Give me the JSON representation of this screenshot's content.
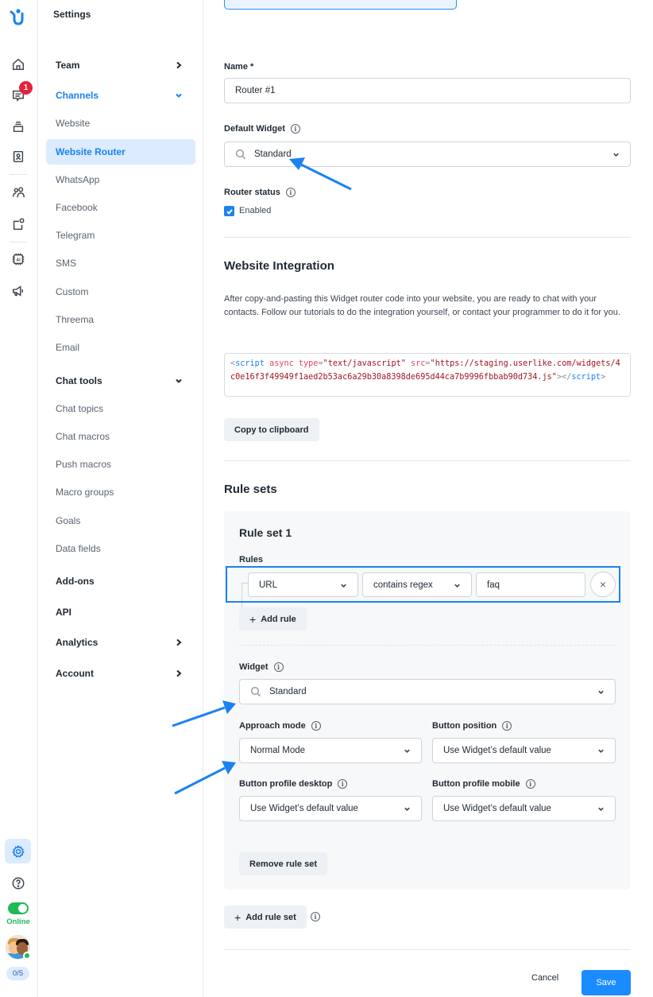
{
  "rail": {
    "icons": [
      "logo-icon",
      "home-icon",
      "chat-icon",
      "inbox-stack-icon",
      "contacts-icon",
      "team-icon",
      "integrations-icon",
      "ai-chip-icon",
      "megaphone-icon"
    ],
    "chat_badge": "1",
    "status_label": "Online",
    "chat_count": "0/5",
    "accent": "#1a82f0",
    "online_color": "#1fb95a"
  },
  "nav": {
    "title": "Settings",
    "items": [
      {
        "label": "Team",
        "type": "group",
        "chevron": "right"
      },
      {
        "label": "Channels",
        "type": "group",
        "chevron": "down",
        "expanded": true
      },
      {
        "label": "Website",
        "type": "sub"
      },
      {
        "label": "Website Router",
        "type": "sub",
        "active": true
      },
      {
        "label": "WhatsApp",
        "type": "sub"
      },
      {
        "label": "Facebook",
        "type": "sub"
      },
      {
        "label": "Telegram",
        "type": "sub"
      },
      {
        "label": "SMS",
        "type": "sub"
      },
      {
        "label": "Custom",
        "type": "sub"
      },
      {
        "label": "Threema",
        "type": "sub"
      },
      {
        "label": "Email",
        "type": "sub"
      },
      {
        "label": "Chat tools",
        "type": "group",
        "chevron": "down",
        "expanded": true
      },
      {
        "label": "Chat topics",
        "type": "sub"
      },
      {
        "label": "Chat macros",
        "type": "sub"
      },
      {
        "label": "Push macros",
        "type": "sub"
      },
      {
        "label": "Macro groups",
        "type": "sub"
      },
      {
        "label": "Goals",
        "type": "sub"
      },
      {
        "label": "Data fields",
        "type": "sub"
      },
      {
        "label": "Add-ons",
        "type": "group"
      },
      {
        "label": "API",
        "type": "group"
      },
      {
        "label": "Analytics",
        "type": "group",
        "chevron": "right"
      },
      {
        "label": "Account",
        "type": "group",
        "chevron": "right"
      }
    ]
  },
  "form": {
    "name_label": "Name *",
    "name_value": "Router #1",
    "default_widget_label": "Default Widget",
    "default_widget_value": "Standard",
    "router_status_label": "Router status",
    "enabled_label": "Enabled",
    "enabled_checked": true
  },
  "integration": {
    "title": "Website Integration",
    "description": "After copy-and-pasting this Widget router code into your website, you are ready to chat with your contacts. Follow our tutorials to do the integration yourself, or contact your programmer to do it for you.",
    "code": {
      "open_bracket": "<",
      "tag": "script",
      "attr_async": "async",
      "attr_type": "type",
      "eq": "=",
      "type_value": "\"text/javascript\"",
      "attr_src": "src",
      "src_value": "\"https://staging.userlike.com/widgets/4c0e16f3f49949f1aed2b53ac6a29b30a8398de695d44ca7b9996fbbab90d734.js\"",
      "close_open": "></",
      "close_end": ">"
    },
    "copy_button": "Copy to clipboard"
  },
  "rule_sets": {
    "title": "Rule sets",
    "sets": [
      {
        "title": "Rule set 1",
        "rules_label": "Rules",
        "rules": [
          {
            "field": "URL",
            "operator": "contains regex",
            "value": "faq"
          }
        ],
        "add_rule": "Add rule",
        "widget_label": "Widget",
        "widget_value": "Standard",
        "approach_mode_label": "Approach mode",
        "approach_mode_value": "Normal Mode",
        "button_position_label": "Button position",
        "button_position_value": "Use Widget’s default value",
        "button_profile_desktop_label": "Button profile desktop",
        "button_profile_desktop_value": "Use Widget’s default value",
        "button_profile_mobile_label": "Button profile mobile",
        "button_profile_mobile_value": "Use Widget’s default value",
        "remove_button": "Remove rule set"
      }
    ],
    "add_rule_set": "Add rule set"
  },
  "footer": {
    "cancel": "Cancel",
    "save": "Save"
  },
  "annotation_color": "#1a82f0"
}
